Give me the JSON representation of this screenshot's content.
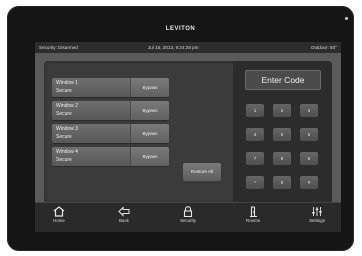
{
  "brand": "LEVITON",
  "status": {
    "security": "Security: Disarmed",
    "datetime": "Jul 15, 2013, 6:24:28 pm",
    "outdoor": "Outdoor: 50°"
  },
  "zones": [
    {
      "name": "Window 1",
      "state": "Secure",
      "bypass": "Bypass"
    },
    {
      "name": "Window 2",
      "state": "Secure",
      "bypass": "Bypass"
    },
    {
      "name": "Window 3",
      "state": "Secure",
      "bypass": "Bypass"
    },
    {
      "name": "Window 4",
      "state": "Secure",
      "bypass": "Bypass"
    }
  ],
  "restore_all": "Restore All",
  "keypad": {
    "display": "Enter Code",
    "keys": [
      "1",
      "2",
      "3",
      "4",
      "5",
      "6",
      "7",
      "8",
      "9",
      "*",
      "0",
      "#"
    ]
  },
  "nav": {
    "home": "Home",
    "back": "Back",
    "security": "Security",
    "rooms": "Rooms",
    "settings": "Settings"
  }
}
